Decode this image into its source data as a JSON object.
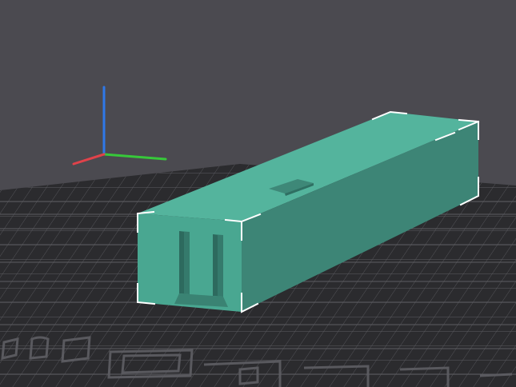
{
  "viewport": {
    "background": "#4b4a50",
    "bed_color": "#2b2b2e",
    "grid_color": "#5a5a5f",
    "model_color": "#4fb39c"
  },
  "axes": {
    "x_color": "#e0424a",
    "y_color": "#37c83a",
    "z_color": "#2f78e8"
  },
  "model": {
    "selected": true,
    "selection_color": "#ffffff"
  },
  "icons": [
    "bed-logo-icon"
  ]
}
